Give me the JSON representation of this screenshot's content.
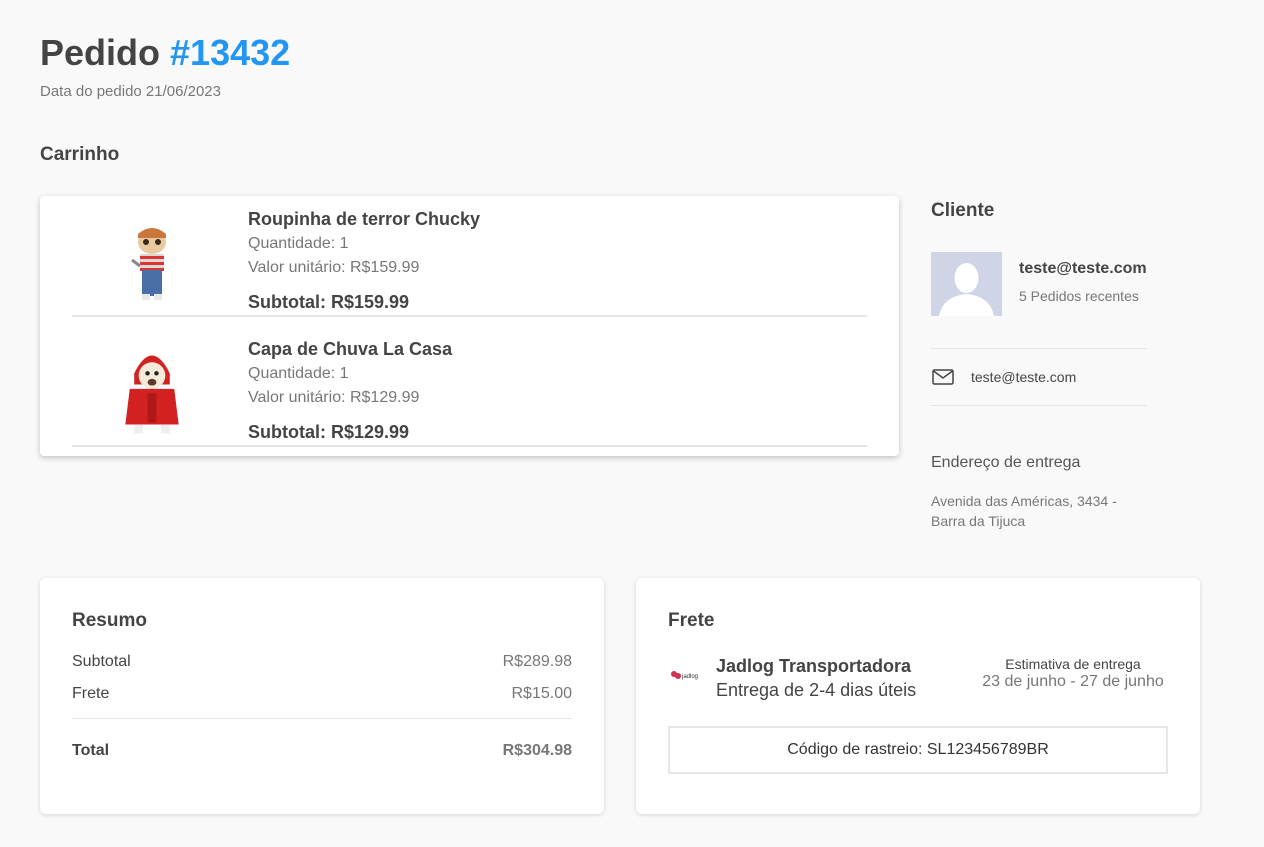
{
  "header": {
    "title_prefix": "Pedido",
    "order_number": "#13432",
    "order_date": "Data do pedido 21/06/2023"
  },
  "cart": {
    "title": "Carrinho",
    "items": [
      {
        "name": "Roupinha de terror Chucky",
        "quantity": "Quantidade: 1",
        "unit_price": "Valor unitário: R$159.99",
        "subtotal": "Subtotal: R$159.99"
      },
      {
        "name": "Capa de Chuva La Casa",
        "quantity": "Quantidade: 1",
        "unit_price": "Valor unitário: R$129.99",
        "subtotal": "Subtotal: R$129.99"
      }
    ]
  },
  "customer": {
    "title": "Cliente",
    "email_primary": "teste@teste.com",
    "recent_orders": "5 Pedidos recentes",
    "contact_email": "teste@teste.com",
    "address_title": "Endereço de entrega",
    "address": "Avenida das Américas, 3434 - Barra da Tijuca"
  },
  "summary": {
    "title": "Resumo",
    "rows": [
      {
        "label": "Subtotal",
        "value": "R$289.98"
      },
      {
        "label": "Frete",
        "value": "R$15.00"
      }
    ],
    "total_label": "Total",
    "total_value": "R$304.98"
  },
  "freight": {
    "title": "Frete",
    "carrier_name": "Jadlog Transportadora",
    "carrier_eta": "Entrega de 2-4 dias úteis",
    "estimate_label": "Estimativa de entrega",
    "estimate_range": "23 de junho - 27 de junho",
    "tracking": "Código de rastreio: SL123456789BR",
    "carrier_logo_text": "jadlog"
  },
  "colors": {
    "accent": "#2196f3",
    "background": "#f9f9f9",
    "card": "#ffffff"
  }
}
